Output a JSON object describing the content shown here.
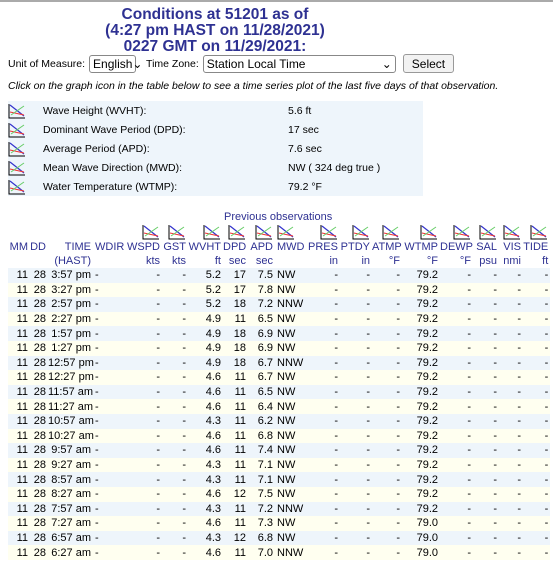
{
  "title": {
    "line1": "Conditions at 51201 as of",
    "line2": "(4:27 pm HAST on 11/28/2021)",
    "line3": "0227 GMT on 11/29/2021:"
  },
  "form": {
    "unit_label": "Unit of Measure:",
    "unit_value": "English",
    "tz_label": "Time Zone:",
    "tz_value": "Station Local Time",
    "select_label": "Select"
  },
  "note": "Click on the graph icon in the table below to see a time series plot of the last five days of that observation.",
  "summary": [
    {
      "label": "Wave Height (WVHT):",
      "value": "5.6 ft"
    },
    {
      "label": "Dominant Wave Period (DPD):",
      "value": "17 sec"
    },
    {
      "label": "Average Period (APD):",
      "value": "7.6 sec"
    },
    {
      "label": "Mean Wave Direction (MWD):",
      "value": "NW ( 324 deg true )"
    },
    {
      "label": "Water Temperature (WTMP):",
      "value": "79.2 °F"
    }
  ],
  "previous": {
    "caption": "Previous observations",
    "columns": [
      {
        "name": "MM",
        "unit": "",
        "graph": false
      },
      {
        "name": "DD",
        "unit": "",
        "graph": false
      },
      {
        "name": "TIME",
        "unit": "(HAST)",
        "graph": false
      },
      {
        "name": "WDIR",
        "unit": "",
        "graph": false
      },
      {
        "name": "WSPD",
        "unit": "kts",
        "graph": true
      },
      {
        "name": "GST",
        "unit": "kts",
        "graph": true
      },
      {
        "name": "WVHT",
        "unit": "ft",
        "graph": true
      },
      {
        "name": "DPD",
        "unit": "sec",
        "graph": true
      },
      {
        "name": "APD",
        "unit": "sec",
        "graph": true
      },
      {
        "name": "MWD",
        "unit": "",
        "graph": true
      },
      {
        "name": "PRES",
        "unit": "in",
        "graph": true
      },
      {
        "name": "PTDY",
        "unit": "in",
        "graph": true
      },
      {
        "name": "ATMP",
        "unit": "°F",
        "graph": true
      },
      {
        "name": "WTMP",
        "unit": "°F",
        "graph": true
      },
      {
        "name": "DEWP",
        "unit": "°F",
        "graph": true
      },
      {
        "name": "SAL",
        "unit": "psu",
        "graph": true
      },
      {
        "name": "VIS",
        "unit": "nmi",
        "graph": true
      },
      {
        "name": "TIDE",
        "unit": "ft",
        "graph": true
      }
    ],
    "rows": [
      [
        "11",
        "28",
        "3:57 pm",
        "-",
        "-",
        "-",
        "5.2",
        "17",
        "7.5",
        "NW",
        "-",
        "-",
        "-",
        "79.2",
        "-",
        "-",
        "-",
        "-"
      ],
      [
        "11",
        "28",
        "3:27 pm",
        "-",
        "-",
        "-",
        "5.2",
        "17",
        "7.8",
        "NW",
        "-",
        "-",
        "-",
        "79.2",
        "-",
        "-",
        "-",
        "-"
      ],
      [
        "11",
        "28",
        "2:57 pm",
        "-",
        "-",
        "-",
        "5.2",
        "18",
        "7.2",
        "NNW",
        "-",
        "-",
        "-",
        "79.2",
        "-",
        "-",
        "-",
        "-"
      ],
      [
        "11",
        "28",
        "2:27 pm",
        "-",
        "-",
        "-",
        "4.9",
        "11",
        "6.5",
        "NW",
        "-",
        "-",
        "-",
        "79.2",
        "-",
        "-",
        "-",
        "-"
      ],
      [
        "11",
        "28",
        "1:57 pm",
        "-",
        "-",
        "-",
        "4.9",
        "18",
        "6.9",
        "NW",
        "-",
        "-",
        "-",
        "79.2",
        "-",
        "-",
        "-",
        "-"
      ],
      [
        "11",
        "28",
        "1:27 pm",
        "-",
        "-",
        "-",
        "4.9",
        "18",
        "6.9",
        "NW",
        "-",
        "-",
        "-",
        "79.2",
        "-",
        "-",
        "-",
        "-"
      ],
      [
        "11",
        "28",
        "12:57 pm",
        "-",
        "-",
        "-",
        "4.9",
        "18",
        "6.7",
        "NNW",
        "-",
        "-",
        "-",
        "79.2",
        "-",
        "-",
        "-",
        "-"
      ],
      [
        "11",
        "28",
        "12:27 pm",
        "-",
        "-",
        "-",
        "4.6",
        "11",
        "6.7",
        "NW",
        "-",
        "-",
        "-",
        "79.2",
        "-",
        "-",
        "-",
        "-"
      ],
      [
        "11",
        "28",
        "11:57 am",
        "-",
        "-",
        "-",
        "4.6",
        "11",
        "6.5",
        "NW",
        "-",
        "-",
        "-",
        "79.2",
        "-",
        "-",
        "-",
        "-"
      ],
      [
        "11",
        "28",
        "11:27 am",
        "-",
        "-",
        "-",
        "4.6",
        "11",
        "6.4",
        "NW",
        "-",
        "-",
        "-",
        "79.2",
        "-",
        "-",
        "-",
        "-"
      ],
      [
        "11",
        "28",
        "10:57 am",
        "-",
        "-",
        "-",
        "4.3",
        "11",
        "6.2",
        "NW",
        "-",
        "-",
        "-",
        "79.2",
        "-",
        "-",
        "-",
        "-"
      ],
      [
        "11",
        "28",
        "10:27 am",
        "-",
        "-",
        "-",
        "4.6",
        "11",
        "6.8",
        "NW",
        "-",
        "-",
        "-",
        "79.2",
        "-",
        "-",
        "-",
        "-"
      ],
      [
        "11",
        "28",
        "9:57 am",
        "-",
        "-",
        "-",
        "4.6",
        "11",
        "7.4",
        "NW",
        "-",
        "-",
        "-",
        "79.2",
        "-",
        "-",
        "-",
        "-"
      ],
      [
        "11",
        "28",
        "9:27 am",
        "-",
        "-",
        "-",
        "4.3",
        "11",
        "7.1",
        "NW",
        "-",
        "-",
        "-",
        "79.2",
        "-",
        "-",
        "-",
        "-"
      ],
      [
        "11",
        "28",
        "8:57 am",
        "-",
        "-",
        "-",
        "4.3",
        "11",
        "7.1",
        "NW",
        "-",
        "-",
        "-",
        "79.2",
        "-",
        "-",
        "-",
        "-"
      ],
      [
        "11",
        "28",
        "8:27 am",
        "-",
        "-",
        "-",
        "4.6",
        "12",
        "7.5",
        "NW",
        "-",
        "-",
        "-",
        "79.2",
        "-",
        "-",
        "-",
        "-"
      ],
      [
        "11",
        "28",
        "7:57 am",
        "-",
        "-",
        "-",
        "4.3",
        "11",
        "7.2",
        "NNW",
        "-",
        "-",
        "-",
        "79.2",
        "-",
        "-",
        "-",
        "-"
      ],
      [
        "11",
        "28",
        "7:27 am",
        "-",
        "-",
        "-",
        "4.6",
        "11",
        "7.3",
        "NW",
        "-",
        "-",
        "-",
        "79.0",
        "-",
        "-",
        "-",
        "-"
      ],
      [
        "11",
        "28",
        "6:57 am",
        "-",
        "-",
        "-",
        "4.3",
        "12",
        "6.8",
        "NW",
        "-",
        "-",
        "-",
        "79.0",
        "-",
        "-",
        "-",
        "-"
      ],
      [
        "11",
        "28",
        "6:27 am",
        "-",
        "-",
        "-",
        "4.6",
        "11",
        "7.0",
        "NNW",
        "-",
        "-",
        "-",
        "79.0",
        "-",
        "-",
        "-",
        "-"
      ]
    ]
  },
  "colors": {
    "heading": "#2e3192",
    "row_blue": "#eef5fb",
    "row_yellow": "#fffff0"
  }
}
